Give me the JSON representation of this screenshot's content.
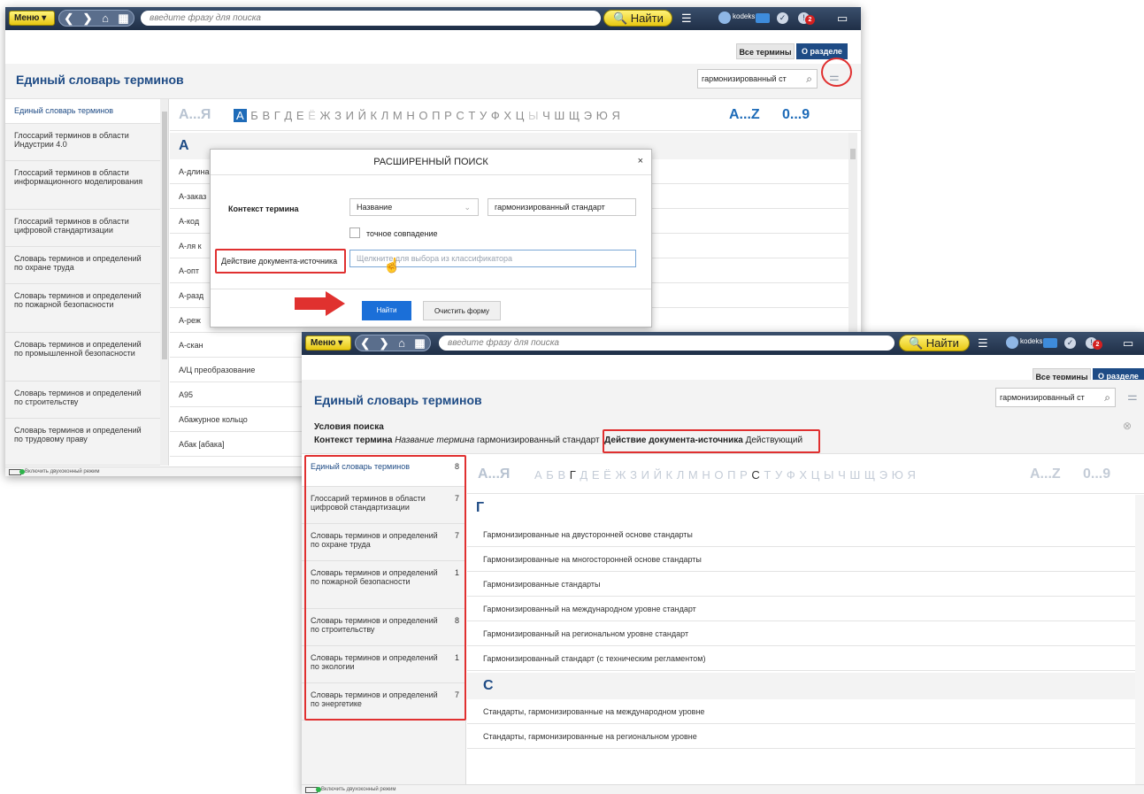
{
  "topbar": {
    "menu_label": "Меню ▾",
    "nav_back": "❮",
    "nav_fwd": "❯",
    "nav_home": "⌂",
    "nav_grid": "▦",
    "search_placeholder": "введите фразу для поиска",
    "find_label": "🔍 Найти",
    "hamburger": "☰",
    "user_name": "kodeks",
    "badge_count": "2",
    "chat_icon": "▭"
  },
  "tabs": {
    "all_terms": "Все термины",
    "about_section": "О разделе"
  },
  "page_title": "Единый словарь терминов",
  "term_search_value": "гармонизированный ст",
  "sliders_icon": "⚌",
  "alphabet": {
    "ru_range": "А...Я",
    "ru_letters": [
      "А",
      "Б",
      "В",
      "Г",
      "Д",
      "Е",
      "Ё",
      "Ж",
      "З",
      "И",
      "Й",
      "К",
      "Л",
      "М",
      "Н",
      "О",
      "П",
      "Р",
      "С",
      "Т",
      "У",
      "Ф",
      "Х",
      "Ц",
      "Ы",
      "Ч",
      "Ш",
      "Щ",
      "Э",
      "Ю",
      "Я"
    ],
    "en_range": "A...Z",
    "num_range": "0...9"
  },
  "back_window": {
    "sidebar": [
      "Единый словарь терминов",
      "Глоссарий терминов в области Индустрии 4.0",
      "Глоссарий терминов в области информационного моделирования",
      "Глоссарий терминов в области цифровой стандартизации",
      "Словарь терминов и определений по охране труда",
      "Словарь терминов и определений по пожарной безопасности",
      "Словарь терминов и определений по промышленной безопасности",
      "Словарь терминов и определений по строительству",
      "Словарь терминов и определений по трудовому праву"
    ],
    "letter": "А",
    "terms": [
      "А-длина",
      "А-заказ",
      "А-код",
      "А-ля к",
      "А-опт",
      "А-разд",
      "А-реж",
      "А-скан",
      "А/Ц преобразование",
      "А95",
      "Абажурное кольцо",
      "Абак [абака]"
    ],
    "footer": "Включить двухоконный режим"
  },
  "modal": {
    "title": "РАСШИРЕННЫЙ ПОИСК",
    "close": "×",
    "context_label": "Контекст термина",
    "context_select": "Название",
    "context_value": "гармонизированный стандарт",
    "exact_match": "точное совпадение",
    "action_label": "Действие документа-источника",
    "action_placeholder": "Щелкните для выбора из классификатора",
    "find_btn": "Найти",
    "clear_btn": "Очистить форму"
  },
  "front_window": {
    "conditions_title": "Условия поиска",
    "cond_context_label": "Контекст термина",
    "cond_context_field": "Название термина",
    "cond_context_value": "гармонизированный стандарт",
    "cond_action_label": "Действие документа-источника",
    "cond_action_value": "Действующий",
    "clear_icon": "⊗",
    "sidebar": [
      {
        "label": "Единый словарь терминов",
        "count": "8"
      },
      {
        "label": "Глоссарий терминов в области цифровой стандартизации",
        "count": "7"
      },
      {
        "label": "Словарь терминов и определений по охране труда",
        "count": "7"
      },
      {
        "label": "Словарь терминов и определений по пожарной безопасности",
        "count": "1"
      },
      {
        "label": "Словарь терминов и определений по строительству",
        "count": "8"
      },
      {
        "label": "Словарь терминов и определений по экологии",
        "count": "1"
      },
      {
        "label": "Словарь терминов и определений по энергетике",
        "count": "7"
      }
    ],
    "groups": [
      {
        "letter": "Г",
        "terms": [
          "Гармонизированные на двусторонней основе стандарты",
          "Гармонизированные на многосторонней основе стандарты",
          "Гармонизированные стандарты",
          "Гармонизированный на международном уровне стандарт",
          "Гармонизированный на региональном уровне стандарт",
          "Гармонизированный стандарт (с техническим регламентом)"
        ]
      },
      {
        "letter": "С",
        "terms": [
          "Стандарты, гармонизированные на международном уровне",
          "Стандарты, гармонизированные на региональном уровне"
        ]
      }
    ],
    "footer": "Включить двухоконный режим"
  },
  "colors": {
    "accent": "#1e4b85",
    "highlight": "#e03030",
    "find": "#f2d630"
  }
}
